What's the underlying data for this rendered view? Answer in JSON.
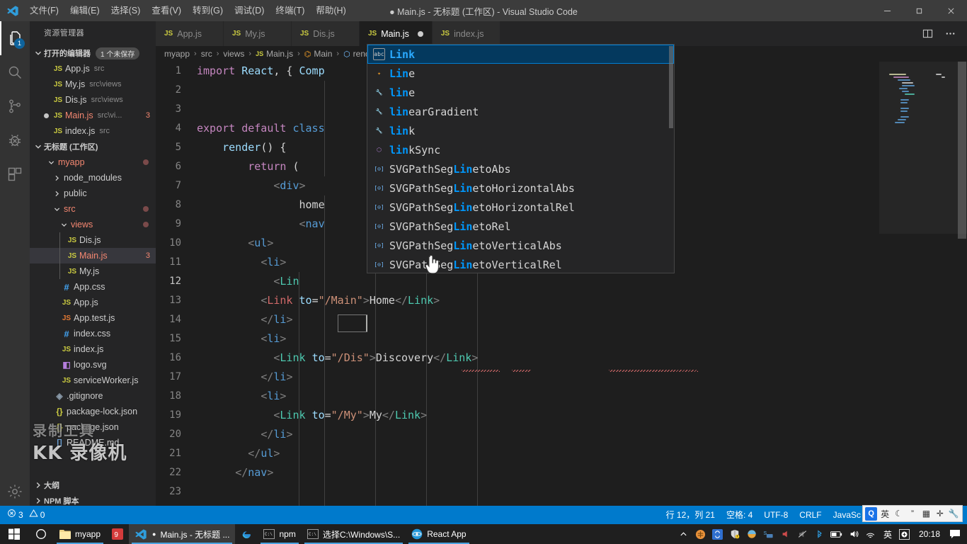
{
  "titlebar": {
    "logo_icon": "vscode-logo-icon",
    "menus": [
      "文件(F)",
      "编辑(E)",
      "选择(S)",
      "查看(V)",
      "转到(G)",
      "调试(D)",
      "终端(T)",
      "帮助(H)"
    ],
    "window_title": "● Main.js - 无标题 (工作区) - Visual Studio Code",
    "minimize_icon": "minimize-icon",
    "maximize_icon": "maximize-icon",
    "close_icon": "close-icon"
  },
  "activitybar": {
    "items": [
      {
        "name": "explorer",
        "icon": "files-icon",
        "badge": "1",
        "active": true
      },
      {
        "name": "search",
        "icon": "search-icon",
        "badge": "",
        "active": false
      },
      {
        "name": "source-control",
        "icon": "source-control-icon",
        "badge": "",
        "active": false
      },
      {
        "name": "debug",
        "icon": "debug-icon",
        "badge": "",
        "active": false
      },
      {
        "name": "extensions",
        "icon": "extensions-icon",
        "badge": "",
        "active": false
      }
    ],
    "settings_icon": "gear-icon"
  },
  "sidebar": {
    "title": "资源管理器",
    "open_editors": {
      "label": "打开的编辑器",
      "badge": "1 个未保存",
      "items": [
        {
          "icon": "js",
          "name": "App.js",
          "desc": "src",
          "dirty": false,
          "errors": ""
        },
        {
          "icon": "js",
          "name": "My.js",
          "desc": "src\\views",
          "dirty": false,
          "errors": ""
        },
        {
          "icon": "js",
          "name": "Dis.js",
          "desc": "src\\views",
          "dirty": false,
          "errors": ""
        },
        {
          "icon": "js",
          "name": "Main.js",
          "desc": "src\\vi...",
          "dirty": true,
          "errors": "3"
        },
        {
          "icon": "js",
          "name": "index.js",
          "desc": "src",
          "dirty": false,
          "errors": ""
        }
      ]
    },
    "workspace": {
      "label": "无标题 (工作区)",
      "root": "myapp",
      "tree": [
        {
          "indent": 2,
          "kind": "folder",
          "name": "myapp",
          "expanded": true,
          "modified": true,
          "errors": ""
        },
        {
          "indent": 3,
          "kind": "folder",
          "name": "node_modules",
          "expanded": false,
          "modified": false,
          "errors": ""
        },
        {
          "indent": 3,
          "kind": "folder",
          "name": "public",
          "expanded": false,
          "modified": false,
          "errors": ""
        },
        {
          "indent": 3,
          "kind": "folder",
          "name": "src",
          "expanded": true,
          "modified": true,
          "errors": ""
        },
        {
          "indent": 4,
          "kind": "folder",
          "name": "views",
          "expanded": true,
          "modified": true,
          "errors": ""
        },
        {
          "indent": 5,
          "kind": "js",
          "name": "Dis.js",
          "expanded": false,
          "modified": false,
          "errors": ""
        },
        {
          "indent": 5,
          "kind": "js",
          "name": "Main.js",
          "expanded": false,
          "modified": false,
          "errors": "3",
          "selected": true
        },
        {
          "indent": 5,
          "kind": "js",
          "name": "My.js",
          "expanded": false,
          "modified": false,
          "errors": ""
        },
        {
          "indent": 4,
          "kind": "css",
          "name": "App.css",
          "expanded": false,
          "modified": false,
          "errors": ""
        },
        {
          "indent": 4,
          "kind": "js",
          "name": "App.js",
          "expanded": false,
          "modified": false,
          "errors": ""
        },
        {
          "indent": 4,
          "kind": "jstest",
          "name": "App.test.js",
          "expanded": false,
          "modified": false,
          "errors": ""
        },
        {
          "indent": 4,
          "kind": "css",
          "name": "index.css",
          "expanded": false,
          "modified": false,
          "errors": ""
        },
        {
          "indent": 4,
          "kind": "js",
          "name": "index.js",
          "expanded": false,
          "modified": false,
          "errors": ""
        },
        {
          "indent": 4,
          "kind": "svg",
          "name": "logo.svg",
          "expanded": false,
          "modified": false,
          "errors": ""
        },
        {
          "indent": 4,
          "kind": "js",
          "name": "serviceWorker.js",
          "expanded": false,
          "modified": false,
          "errors": ""
        },
        {
          "indent": 3,
          "kind": "git",
          "name": ".gitignore",
          "expanded": false,
          "modified": false,
          "errors": ""
        },
        {
          "indent": 3,
          "kind": "json",
          "name": "package-lock.json",
          "expanded": false,
          "modified": false,
          "errors": ""
        },
        {
          "indent": 3,
          "kind": "json",
          "name": "package.json",
          "expanded": false,
          "modified": false,
          "errors": ""
        },
        {
          "indent": 3,
          "kind": "md",
          "name": "README.md",
          "expanded": false,
          "modified": false,
          "errors": ""
        }
      ]
    },
    "bottom_sections": [
      "大纲",
      "NPM 脚本"
    ]
  },
  "tabs": {
    "items": [
      {
        "label": "App.js",
        "icon": "js-file-icon",
        "active": false,
        "dirty": false
      },
      {
        "label": "My.js",
        "icon": "js-file-icon",
        "active": false,
        "dirty": false
      },
      {
        "label": "Dis.js",
        "icon": "js-file-icon",
        "active": false,
        "dirty": false
      },
      {
        "label": "Main.js",
        "icon": "js-file-icon",
        "active": true,
        "dirty": true
      },
      {
        "label": "index.js",
        "icon": "js-file-icon",
        "active": false,
        "dirty": false
      }
    ],
    "actions": {
      "split_icon": "split-editor-icon",
      "more_icon": "more-actions-icon"
    }
  },
  "breadcrumbs": [
    {
      "label": "myapp",
      "icon": ""
    },
    {
      "label": "src",
      "icon": ""
    },
    {
      "label": "views",
      "icon": ""
    },
    {
      "label": "Main.js",
      "icon": "js-file-icon"
    },
    {
      "label": "Main",
      "icon": "class-icon"
    },
    {
      "label": "render",
      "icon": "method-icon"
    }
  ],
  "code": {
    "lines": [
      {
        "n": 1,
        "tokens": [
          {
            "t": "import ",
            "c": "kw"
          },
          {
            "t": "React",
            "c": "id"
          },
          {
            "t": ", { ",
            "c": "punc"
          },
          {
            "t": "Comp",
            "c": "id"
          }
        ]
      },
      {
        "n": 2,
        "tokens": []
      },
      {
        "n": 3,
        "tokens": []
      },
      {
        "n": 4,
        "tokens": [
          {
            "t": "export ",
            "c": "kw"
          },
          {
            "t": "default ",
            "c": "kw"
          },
          {
            "t": "class ",
            "c": "kw2"
          }
        ]
      },
      {
        "n": 5,
        "tokens": [
          {
            "t": "    ",
            "c": "punc"
          },
          {
            "t": "render",
            "c": "fn"
          },
          {
            "t": "() {",
            "c": "punc"
          }
        ]
      },
      {
        "n": 6,
        "tokens": [
          {
            "t": "        ",
            "c": "punc"
          },
          {
            "t": "return ",
            "c": "kw"
          },
          {
            "t": "(",
            "c": "punc"
          }
        ]
      },
      {
        "n": 7,
        "tokens": [
          {
            "t": "            ",
            "c": "punc"
          },
          {
            "t": "<",
            "c": "tagb"
          },
          {
            "t": "div",
            "c": "tag"
          },
          {
            "t": ">",
            "c": "tagb"
          }
        ]
      },
      {
        "n": 8,
        "tokens": [
          {
            "t": "                ",
            "c": "punc"
          },
          {
            "t": "home",
            "c": "txt"
          }
        ]
      },
      {
        "n": 9,
        "tokens": [
          {
            "t": "                ",
            "c": "punc"
          },
          {
            "t": "<",
            "c": "tagb"
          },
          {
            "t": "nav",
            "c": "tag"
          }
        ]
      },
      {
        "n": 10,
        "tokens": [
          {
            "t": "        ",
            "c": "punc"
          },
          {
            "t": "<",
            "c": "tagb"
          },
          {
            "t": "ul",
            "c": "tag"
          },
          {
            "t": ">",
            "c": "tagb"
          }
        ]
      },
      {
        "n": 11,
        "tokens": [
          {
            "t": "          ",
            "c": "punc"
          },
          {
            "t": "<",
            "c": "tagb"
          },
          {
            "t": "li",
            "c": "tag"
          },
          {
            "t": ">",
            "c": "tagb"
          }
        ]
      },
      {
        "n": 12,
        "tokens": [
          {
            "t": "            ",
            "c": "punc"
          },
          {
            "t": "<",
            "c": "tagb"
          },
          {
            "t": "Lin",
            "c": "tagL"
          }
        ]
      },
      {
        "n": 13,
        "tokens": [
          {
            "t": "          ",
            "c": "punc"
          },
          {
            "t": "<",
            "c": "tagb"
          },
          {
            "t": "Link",
            "c": "tagLerr"
          },
          {
            "t": " ",
            "c": "punc"
          },
          {
            "t": "to",
            "c": "attr"
          },
          {
            "t": "=",
            "c": "punc"
          },
          {
            "t": "\"/Main\"",
            "c": "str"
          },
          {
            "t": ">",
            "c": "tagb"
          },
          {
            "t": "Home",
            "c": "txt"
          },
          {
            "t": "</",
            "c": "tagb"
          },
          {
            "t": "Link",
            "c": "tagL"
          },
          {
            "t": ">",
            "c": "tagb"
          }
        ]
      },
      {
        "n": 14,
        "tokens": [
          {
            "t": "          ",
            "c": "punc"
          },
          {
            "t": "</",
            "c": "tagb"
          },
          {
            "t": "li",
            "c": "tag"
          },
          {
            "t": ">",
            "c": "tagb"
          }
        ]
      },
      {
        "n": 15,
        "tokens": [
          {
            "t": "          ",
            "c": "punc"
          },
          {
            "t": "<",
            "c": "tagb"
          },
          {
            "t": "li",
            "c": "tag"
          },
          {
            "t": ">",
            "c": "tagb"
          }
        ]
      },
      {
        "n": 16,
        "tokens": [
          {
            "t": "            ",
            "c": "punc"
          },
          {
            "t": "<",
            "c": "tagb"
          },
          {
            "t": "Link",
            "c": "tagL"
          },
          {
            "t": " ",
            "c": "punc"
          },
          {
            "t": "to",
            "c": "attr"
          },
          {
            "t": "=",
            "c": "punc"
          },
          {
            "t": "\"/Dis\"",
            "c": "str"
          },
          {
            "t": ">",
            "c": "tagb"
          },
          {
            "t": "Discovery",
            "c": "txt"
          },
          {
            "t": "</",
            "c": "tagb"
          },
          {
            "t": "Link",
            "c": "tagL"
          },
          {
            "t": ">",
            "c": "tagb"
          }
        ]
      },
      {
        "n": 17,
        "tokens": [
          {
            "t": "          ",
            "c": "punc"
          },
          {
            "t": "</",
            "c": "tagb"
          },
          {
            "t": "li",
            "c": "tag"
          },
          {
            "t": ">",
            "c": "tagb"
          }
        ]
      },
      {
        "n": 18,
        "tokens": [
          {
            "t": "          ",
            "c": "punc"
          },
          {
            "t": "<",
            "c": "tagb"
          },
          {
            "t": "li",
            "c": "tag"
          },
          {
            "t": ">",
            "c": "tagb"
          }
        ]
      },
      {
        "n": 19,
        "tokens": [
          {
            "t": "            ",
            "c": "punc"
          },
          {
            "t": "<",
            "c": "tagb"
          },
          {
            "t": "Link",
            "c": "tagL"
          },
          {
            "t": " ",
            "c": "punc"
          },
          {
            "t": "to",
            "c": "attr"
          },
          {
            "t": "=",
            "c": "punc"
          },
          {
            "t": "\"/My\"",
            "c": "str"
          },
          {
            "t": ">",
            "c": "tagb"
          },
          {
            "t": "My",
            "c": "txt"
          },
          {
            "t": "</",
            "c": "tagb"
          },
          {
            "t": "Link",
            "c": "tagL"
          },
          {
            "t": ">",
            "c": "tagb"
          }
        ]
      },
      {
        "n": 20,
        "tokens": [
          {
            "t": "          ",
            "c": "punc"
          },
          {
            "t": "</",
            "c": "tagb"
          },
          {
            "t": "li",
            "c": "tag"
          },
          {
            "t": ">",
            "c": "tagb"
          }
        ]
      },
      {
        "n": 21,
        "tokens": [
          {
            "t": "        ",
            "c": "punc"
          },
          {
            "t": "</",
            "c": "tagb"
          },
          {
            "t": "ul",
            "c": "tag"
          },
          {
            "t": ">",
            "c": "tagb"
          }
        ]
      },
      {
        "n": 22,
        "tokens": [
          {
            "t": "      ",
            "c": "punc"
          },
          {
            "t": "</",
            "c": "tagb"
          },
          {
            "t": "nav",
            "c": "tag"
          },
          {
            "t": ">",
            "c": "tagb"
          }
        ]
      },
      {
        "n": 23,
        "tokens": []
      }
    ],
    "typed_text": "<Lin",
    "cursor_line": 12,
    "cursor_col": 21
  },
  "suggest": {
    "items": [
      {
        "label": "Link",
        "match": "Link",
        "icon": "abc",
        "selected": true
      },
      {
        "label": "Line",
        "match": "Lin",
        "icon": "struct",
        "selected": false
      },
      {
        "label": "line",
        "match": "lin",
        "icon": "prop",
        "selected": false
      },
      {
        "label": "linearGradient",
        "match": "lin",
        "icon": "prop",
        "selected": false
      },
      {
        "label": "link",
        "match": "lin",
        "icon": "prop",
        "selected": false
      },
      {
        "label": "linkSync",
        "match": "lin",
        "icon": "module",
        "selected": false
      },
      {
        "label": "SVGPathSegLinetoAbs",
        "match": "Lin",
        "icon": "iface",
        "selected": false
      },
      {
        "label": "SVGPathSegLinetoHorizontalAbs",
        "match": "Lin",
        "icon": "iface",
        "selected": false
      },
      {
        "label": "SVGPathSegLinetoHorizontalRel",
        "match": "Lin",
        "icon": "iface",
        "selected": false
      },
      {
        "label": "SVGPathSegLinetoRel",
        "match": "Lin",
        "icon": "iface",
        "selected": false
      },
      {
        "label": "SVGPathSegLinetoVerticalAbs",
        "match": "Lin",
        "icon": "iface",
        "selected": false
      },
      {
        "label": "SVGPathSegLinetoVerticalRel",
        "match": "Lin",
        "icon": "iface",
        "selected": false
      }
    ]
  },
  "statusbar": {
    "errors_icon": "error-icon",
    "errors": "3",
    "warnings_icon": "warning-icon",
    "warnings": "0",
    "position": "行 12，列 21",
    "indent": "空格: 4",
    "encoding": "UTF-8",
    "eol": "CRLF",
    "language": "JavaSc"
  },
  "ime": {
    "items": [
      "Q",
      "英",
      "☾",
      "”",
      "▦",
      "✛",
      "🔧"
    ]
  },
  "taskbar": {
    "start_icon": "windows-start-icon",
    "cortana_icon": "cortana-circle-icon",
    "items": [
      {
        "label": "myapp",
        "icon": "folder-icon",
        "active": false,
        "running": true,
        "dirty": false
      },
      {
        "label": "",
        "icon": "qq-icon",
        "active": false,
        "running": false,
        "dirty": false
      },
      {
        "label": "Main.js - 无标题 ...",
        "icon": "vscode-icon",
        "active": true,
        "running": true,
        "dirty": true
      },
      {
        "label": "",
        "icon": "edge-icon",
        "active": false,
        "running": false,
        "dirty": false
      },
      {
        "label": "npm",
        "icon": "console-icon",
        "active": false,
        "running": true,
        "dirty": false
      },
      {
        "label": "选择C:\\Windows\\S...",
        "icon": "console-icon",
        "active": false,
        "running": true,
        "dirty": false
      },
      {
        "label": "React App",
        "icon": "react-icon",
        "active": false,
        "running": true,
        "dirty": false
      }
    ],
    "tray": [
      "^",
      "◉",
      "↻",
      "🛡",
      "◕",
      "S",
      "🔊",
      "🚫",
      "ᛒ",
      "▭",
      "◂))",
      "⌁",
      "英",
      "Q"
    ],
    "clock": "20:18",
    "notification_icon": "notification-icon"
  },
  "watermark": {
    "line1": "录制工具",
    "line2": "KK 录像机"
  }
}
